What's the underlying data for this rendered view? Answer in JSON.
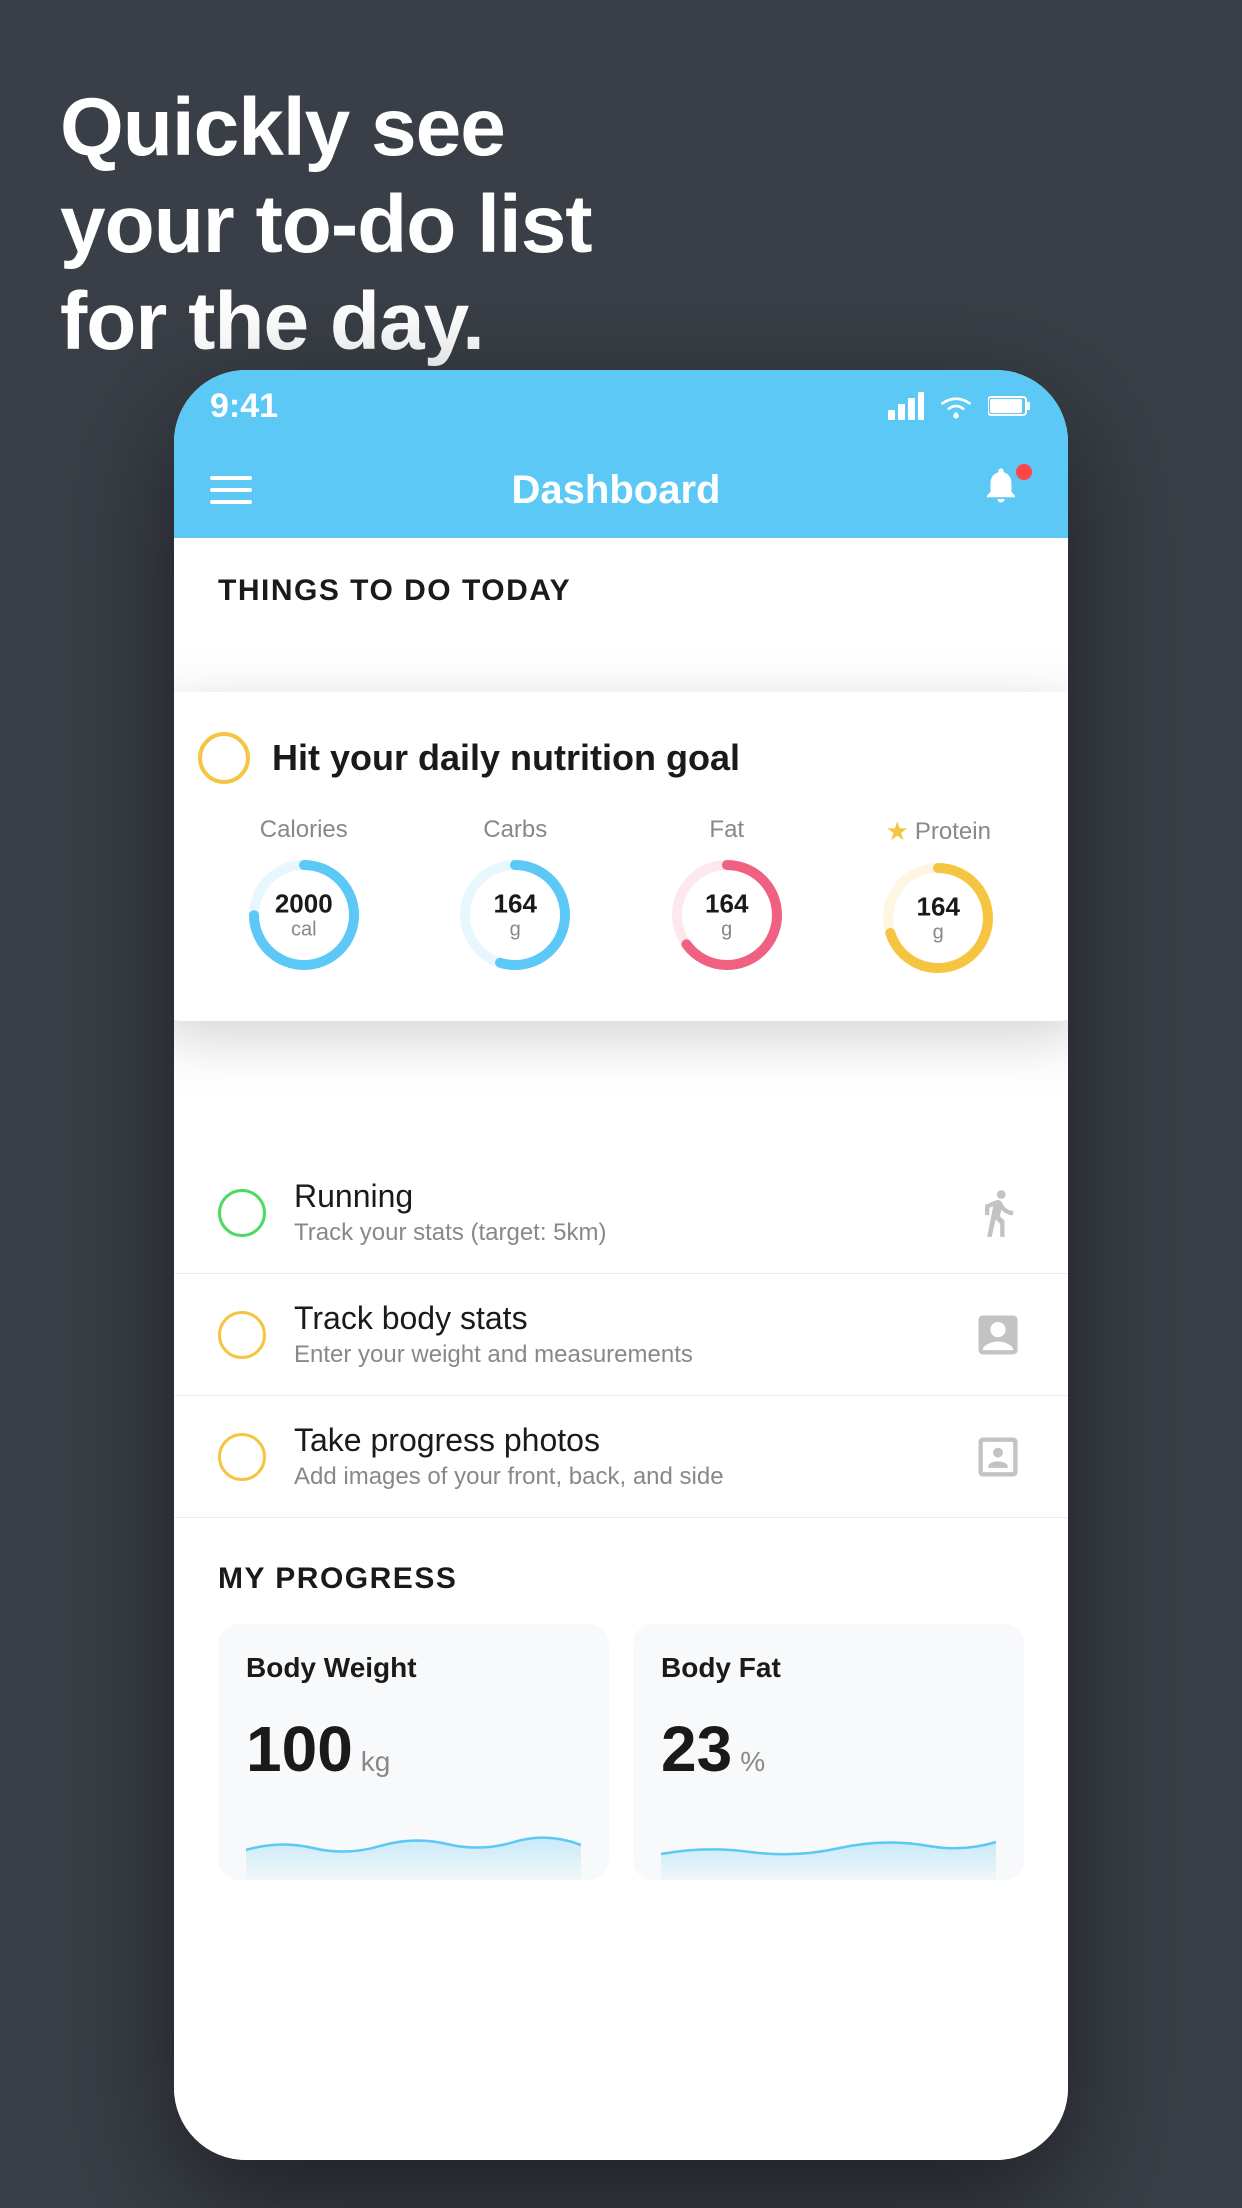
{
  "headline": {
    "line1": "Quickly see",
    "line2": "your to-do list",
    "line3": "for the day."
  },
  "status_bar": {
    "time": "9:41",
    "signal": "▋▋▋",
    "wifi": "wifi",
    "battery": "battery"
  },
  "nav": {
    "title": "Dashboard"
  },
  "section": {
    "today_label": "THINGS TO DO TODAY"
  },
  "nutrition_card": {
    "check_label": "Hit your daily nutrition goal",
    "macros": [
      {
        "label": "Calories",
        "value": "2000",
        "unit": "cal",
        "color": "#5bc8f5",
        "track": 75,
        "star": false
      },
      {
        "label": "Carbs",
        "value": "164",
        "unit": "g",
        "color": "#5bc8f5",
        "track": 55,
        "star": false
      },
      {
        "label": "Fat",
        "value": "164",
        "unit": "g",
        "color": "#f06080",
        "track": 65,
        "star": false
      },
      {
        "label": "Protein",
        "value": "164",
        "unit": "g",
        "color": "#f5c542",
        "track": 70,
        "star": true
      }
    ]
  },
  "todo_items": [
    {
      "title": "Running",
      "subtitle": "Track your stats (target: 5km)",
      "circle": "green",
      "icon": "shoe"
    },
    {
      "title": "Track body stats",
      "subtitle": "Enter your weight and measurements",
      "circle": "yellow",
      "icon": "scale"
    },
    {
      "title": "Take progress photos",
      "subtitle": "Add images of your front, back, and side",
      "circle": "yellow",
      "icon": "portrait"
    }
  ],
  "progress": {
    "section_label": "MY PROGRESS",
    "cards": [
      {
        "title": "Body Weight",
        "value": "100",
        "unit": "kg"
      },
      {
        "title": "Body Fat",
        "value": "23",
        "unit": "%"
      }
    ]
  }
}
